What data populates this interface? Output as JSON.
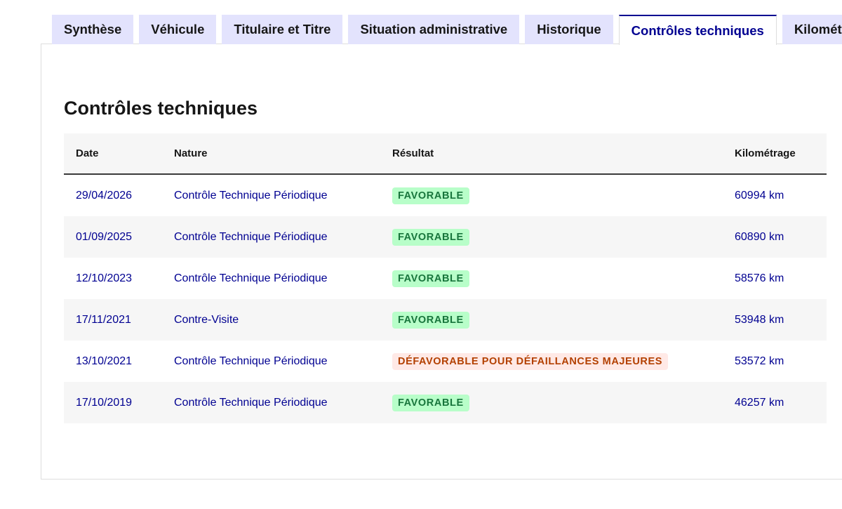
{
  "tabs": [
    {
      "label": "Synthèse",
      "active": false
    },
    {
      "label": "Véhicule",
      "active": false
    },
    {
      "label": "Titulaire et Titre",
      "active": false
    },
    {
      "label": "Situation administrative",
      "active": false
    },
    {
      "label": "Historique",
      "active": false
    },
    {
      "label": "Contrôles techniques",
      "active": true
    },
    {
      "label": "Kilométrage",
      "active": false
    }
  ],
  "section": {
    "title": "Contrôles techniques"
  },
  "table": {
    "headers": {
      "date": "Date",
      "nature": "Nature",
      "result": "Résultat",
      "km": "Kilométrage"
    },
    "rows": [
      {
        "date": "29/04/2026",
        "nature": "Contrôle Technique Périodique",
        "result": "FAVORABLE",
        "status": "favorable",
        "km": "60994 km"
      },
      {
        "date": "01/09/2025",
        "nature": "Contrôle Technique Périodique",
        "result": "FAVORABLE",
        "status": "favorable",
        "km": "60890 km"
      },
      {
        "date": "12/10/2023",
        "nature": "Contrôle Technique Périodique",
        "result": "FAVORABLE",
        "status": "favorable",
        "km": "58576 km"
      },
      {
        "date": "17/11/2021",
        "nature": "Contre-Visite",
        "result": "FAVORABLE",
        "status": "favorable",
        "km": "53948 km"
      },
      {
        "date": "13/10/2021",
        "nature": "Contrôle Technique Périodique",
        "result": "DÉFAVORABLE POUR DÉFAILLANCES MAJEURES",
        "status": "defavorable",
        "km": "53572 km"
      },
      {
        "date": "17/10/2019",
        "nature": "Contrôle Technique Périodique",
        "result": "FAVORABLE",
        "status": "favorable",
        "km": "46257 km"
      }
    ]
  },
  "colors": {
    "accent": "#000091",
    "tab_bg": "#e3e3fd",
    "favorable_bg": "#b8fec9",
    "favorable_text": "#18753c",
    "defavorable_bg": "#ffe9e6",
    "defavorable_text": "#b34000"
  }
}
